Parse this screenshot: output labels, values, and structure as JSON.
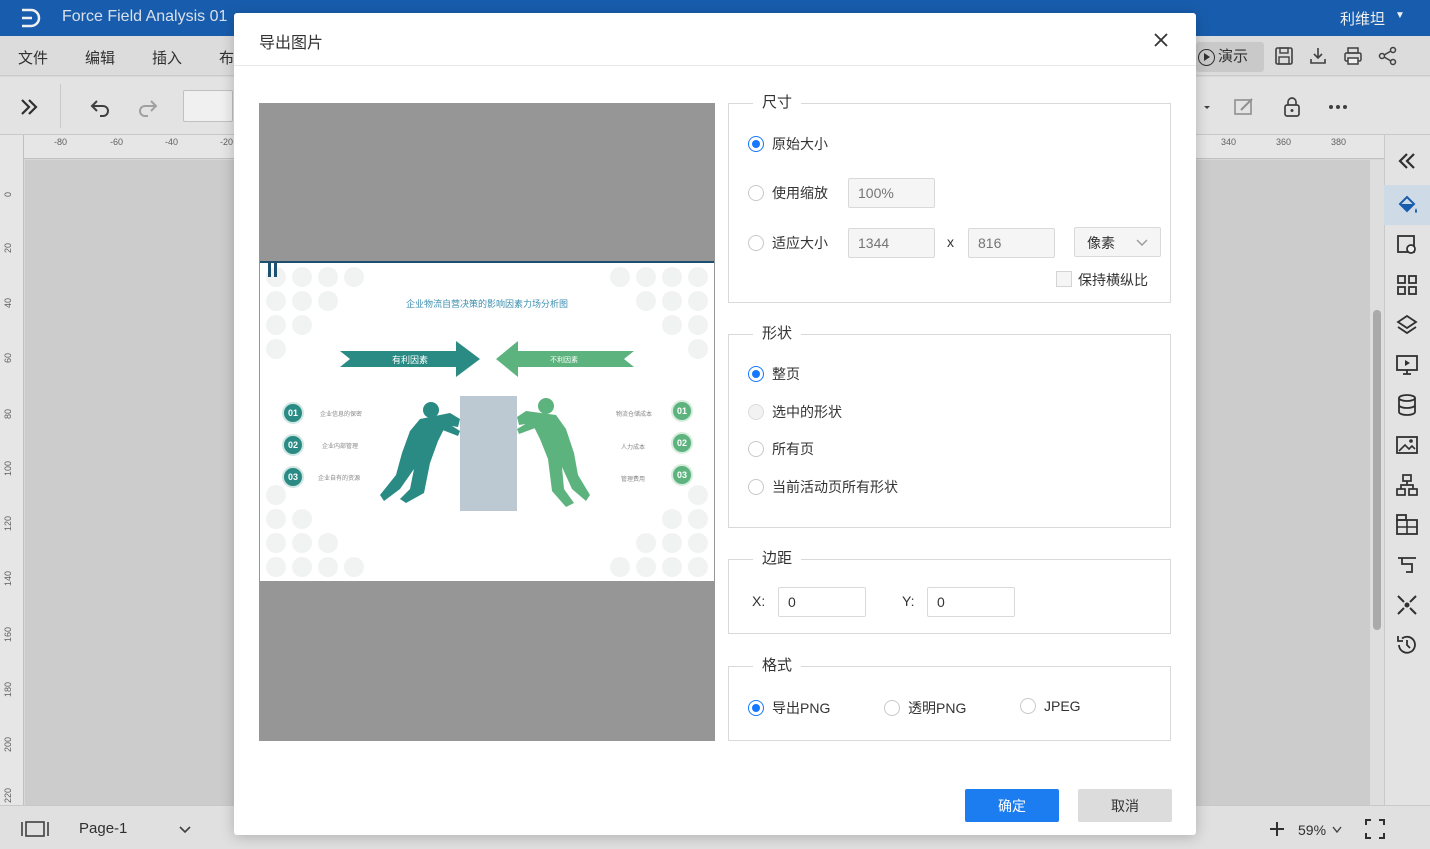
{
  "app": {
    "title": "Force Field Analysis 01",
    "user_name": "利维坦"
  },
  "menu": {
    "file": "文件",
    "edit": "编辑",
    "insert": "插入",
    "layout_partial": "布",
    "present": "演示"
  },
  "ruler": {
    "h_labels": [
      "-80",
      "-60",
      "-40",
      "-20",
      "340",
      "360",
      "380"
    ],
    "v_labels": [
      "0",
      "20",
      "40",
      "60",
      "80",
      "100",
      "120",
      "140",
      "160",
      "180",
      "200",
      "220"
    ]
  },
  "statusbar": {
    "page": "Page-1",
    "zoom": "59%"
  },
  "dialog": {
    "title": "导出图片",
    "size": {
      "legend": "尺寸",
      "original": "原始大小",
      "use_scale": "使用缩放",
      "scale_placeholder": "100%",
      "fit_size": "适应大小",
      "width_placeholder": "1344",
      "times": "x",
      "height_placeholder": "816",
      "unit": "像素",
      "keep_ratio": "保持横纵比"
    },
    "shape": {
      "legend": "形状",
      "whole_page": "整页",
      "selected": "选中的形状",
      "all_pages": "所有页",
      "current_page_all": "当前活动页所有形状"
    },
    "margin": {
      "legend": "边距",
      "x_label": "X:",
      "x_value": "0",
      "y_label": "Y:",
      "y_value": "0"
    },
    "format": {
      "legend": "格式",
      "png": "导出PNG",
      "transparent_png": "透明PNG",
      "jpeg": "JPEG"
    },
    "ok": "确定",
    "cancel": "取消"
  },
  "preview": {
    "title": "企业物流自营决策的影响因素力场分析图",
    "left_arrow": "有利因素",
    "right_arrow": "不利因素",
    "left_items": [
      {
        "num": "01",
        "text": "企业信息的保密"
      },
      {
        "num": "02",
        "text": "企业内部管理"
      },
      {
        "num": "03",
        "text": "企业自有的资源"
      }
    ],
    "right_items": [
      {
        "num": "01",
        "text": "物流仓储成本"
      },
      {
        "num": "02",
        "text": "人力成本"
      },
      {
        "num": "03",
        "text": "管理费用"
      }
    ],
    "colors": {
      "teal": "#2a8a84",
      "green": "#5db37e",
      "box": "#bcc8d2"
    }
  }
}
